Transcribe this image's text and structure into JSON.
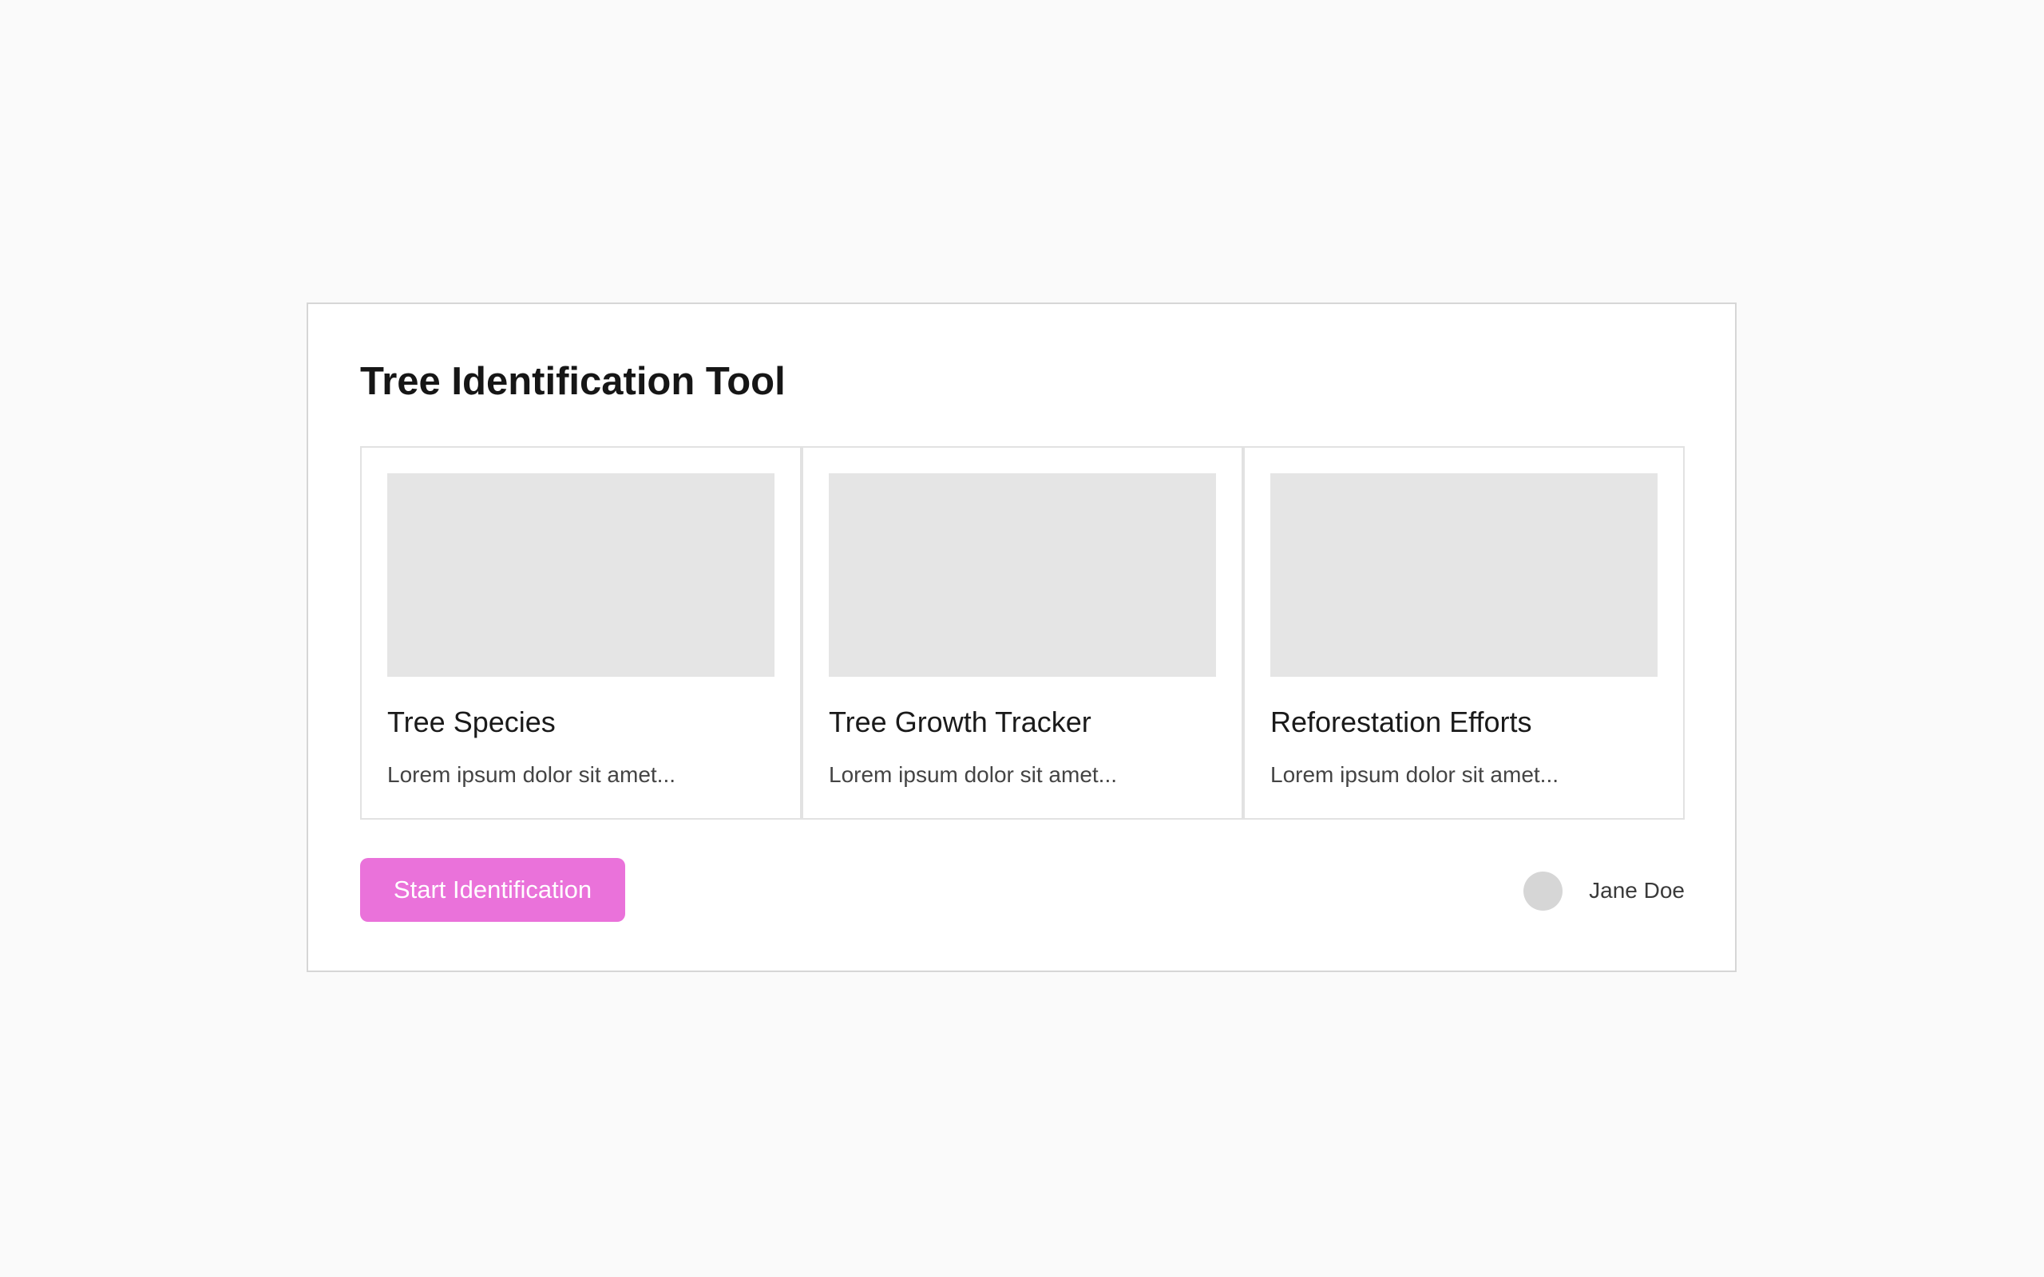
{
  "app": {
    "title": "Tree Identification Tool"
  },
  "cards": [
    {
      "title": "Tree Species",
      "description": "Lorem ipsum dolor sit amet..."
    },
    {
      "title": "Tree Growth Tracker",
      "description": "Lorem ipsum dolor sit amet..."
    },
    {
      "title": "Reforestation Efforts",
      "description": "Lorem ipsum dolor sit amet..."
    }
  ],
  "actions": {
    "start_label": "Start Identification"
  },
  "user": {
    "name": "Jane Doe"
  },
  "colors": {
    "accent": "#ea72da",
    "placeholder": "#e5e5e5"
  }
}
